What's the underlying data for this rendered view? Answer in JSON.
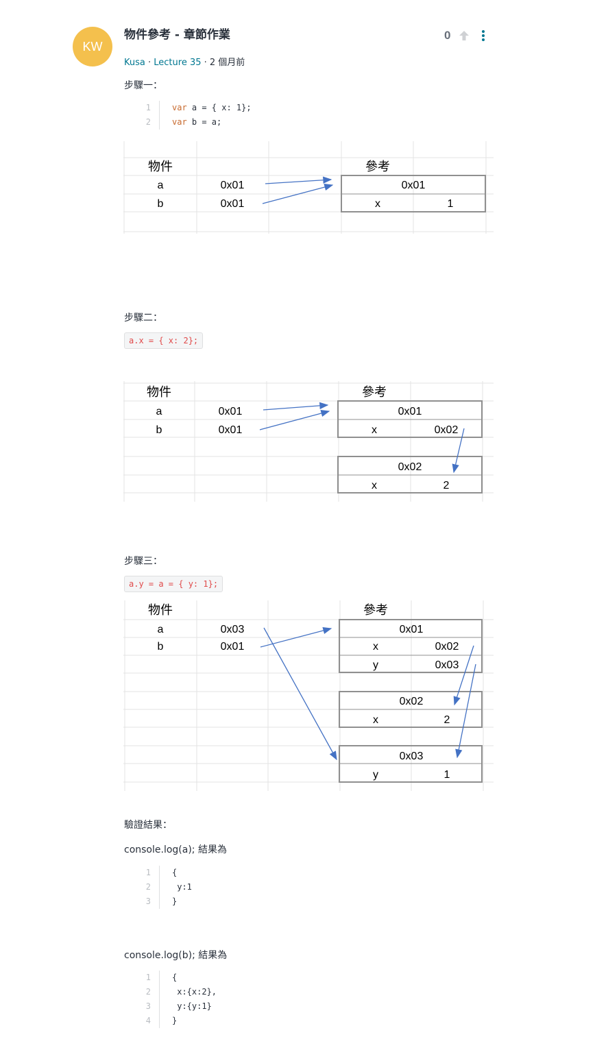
{
  "post": {
    "avatar_initials": "KW",
    "title": "物件參考 - 章節作業",
    "author": "Kusa",
    "lecture": "Lecture 35",
    "time": "· 2 個月前",
    "votes": "0"
  },
  "step1": {
    "label": "步驟一：",
    "code": [
      {
        "ln": "1",
        "kw": "var",
        "rest": " a = { x: 1};"
      },
      {
        "ln": "2",
        "kw": "var",
        "rest": " b = a;"
      }
    ],
    "table": {
      "obj_header": "物件",
      "ref_header": "參考",
      "rows": [
        {
          "name": "a",
          "addr": "0x01"
        },
        {
          "name": "b",
          "addr": "0x01"
        }
      ],
      "refs": [
        {
          "addr": "0x01",
          "props": [
            {
              "k": "x",
              "v": "1"
            }
          ]
        }
      ]
    }
  },
  "step2": {
    "label": "步驟二：",
    "code": "a.x = { x: 2};",
    "table": {
      "obj_header": "物件",
      "ref_header": "參考",
      "rows": [
        {
          "name": "a",
          "addr": "0x01"
        },
        {
          "name": "b",
          "addr": "0x01"
        }
      ],
      "refs": [
        {
          "addr": "0x01",
          "props": [
            {
              "k": "x",
              "v": "0x02"
            }
          ]
        },
        {
          "addr": "0x02",
          "props": [
            {
              "k": "x",
              "v": "2"
            }
          ]
        }
      ]
    }
  },
  "step3": {
    "label": "步驟三：",
    "code": "a.y = a = { y: 1};",
    "table": {
      "obj_header": "物件",
      "ref_header": "參考",
      "rows": [
        {
          "name": "a",
          "addr": "0x03"
        },
        {
          "name": "b",
          "addr": "0x01"
        }
      ],
      "refs": [
        {
          "addr": "0x01",
          "props": [
            {
              "k": "x",
              "v": "0x02"
            },
            {
              "k": "y",
              "v": "0x03"
            }
          ]
        },
        {
          "addr": "0x02",
          "props": [
            {
              "k": "x",
              "v": "2"
            }
          ]
        },
        {
          "addr": "0x03",
          "props": [
            {
              "k": "y",
              "v": "1"
            }
          ]
        }
      ]
    }
  },
  "verify": {
    "label": "驗證結果：",
    "log_a": "console.log(a);  結果為",
    "code_a": [
      {
        "ln": "1",
        "text": "{"
      },
      {
        "ln": "2",
        "text": " y:1"
      },
      {
        "ln": "3",
        "text": "}"
      }
    ],
    "log_b": "console.log(b);  結果為",
    "code_b": [
      {
        "ln": "1",
        "text": "{"
      },
      {
        "ln": "2",
        "text": " x:{x:2},"
      },
      {
        "ln": "3",
        "text": " y:{y:1}"
      },
      {
        "ln": "4",
        "text": "}"
      }
    ]
  },
  "colors": {
    "avatar": "#f4c04d",
    "link": "#007791",
    "arrow": "#4472c4",
    "inline_code": "#e04848"
  }
}
